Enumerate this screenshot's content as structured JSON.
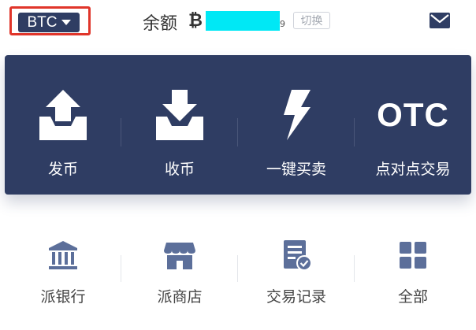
{
  "header": {
    "coin": "BTC",
    "balance_label": "余额",
    "currency_symbol": "₿",
    "balance_tail": "9",
    "switch_label": "切换",
    "mail_icon": "mail-icon"
  },
  "actions": [
    {
      "label": "发币",
      "icon": "send-tray-icon"
    },
    {
      "label": "收币",
      "icon": "receive-tray-icon"
    },
    {
      "label": "一键买卖",
      "icon": "lightning-icon"
    },
    {
      "label": "点对点交易",
      "icon": "otc-icon",
      "icon_text": "OTC"
    }
  ],
  "services": [
    {
      "label": "派银行",
      "icon": "bank-icon"
    },
    {
      "label": "派商店",
      "icon": "store-icon"
    },
    {
      "label": "交易记录",
      "icon": "records-icon"
    },
    {
      "label": "全部",
      "icon": "grid-icon"
    }
  ],
  "colors": {
    "panel": "#2f3d63",
    "highlight_border": "#e0352a",
    "mask": "#00e8f5",
    "service_icon": "#5c6f9a"
  }
}
